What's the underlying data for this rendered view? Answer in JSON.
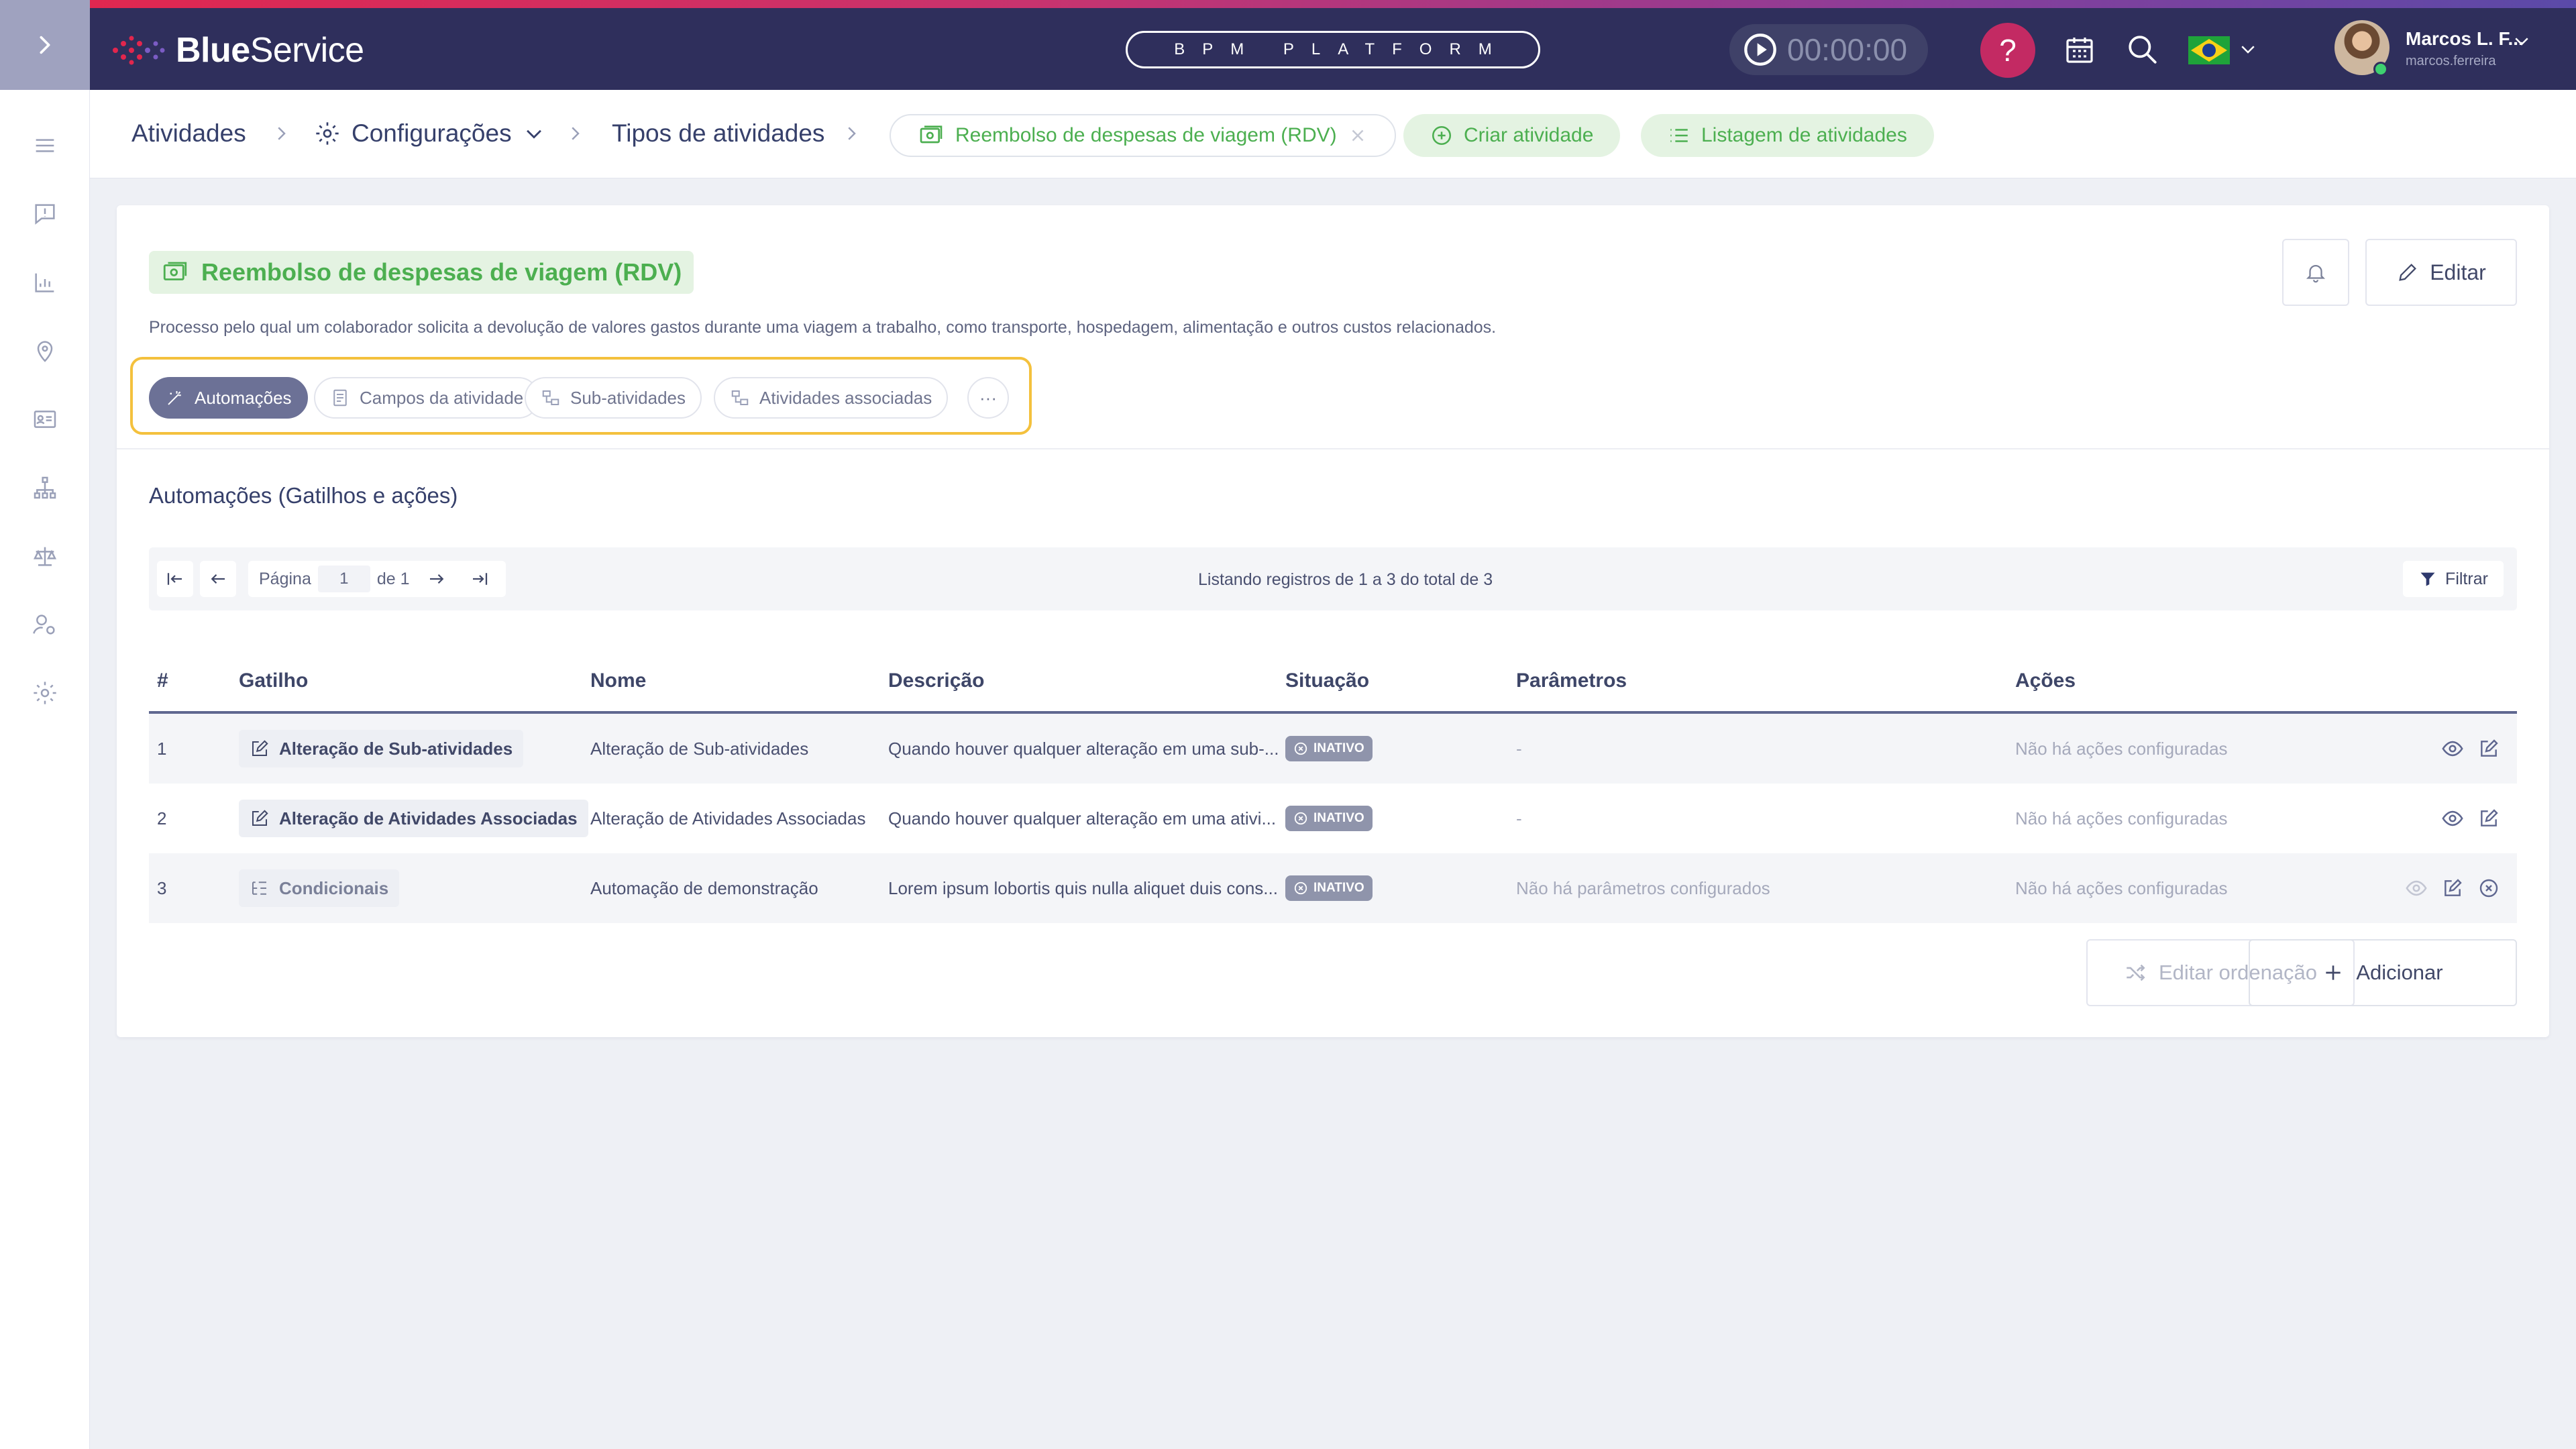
{
  "app": {
    "brand_bold": "Blue",
    "brand_light": "Service",
    "platform_label": "BPM PLATFORM",
    "timer": "00:00:00",
    "help_label": "?",
    "language": "pt-BR",
    "user": {
      "name": "Marcos L. F...",
      "login": "marcos.ferreira"
    },
    "colors": {
      "topbar": "#2f2f5c",
      "accent_green": "#4caf50",
      "highlight": "#f4c13d",
      "status_inactive": "#8f94ab"
    }
  },
  "sidebar": {
    "items": [
      {
        "icon": "list-icon"
      },
      {
        "icon": "alert-message-icon"
      },
      {
        "icon": "bar-chart-icon"
      },
      {
        "icon": "map-pin-icon"
      },
      {
        "icon": "id-card-icon"
      },
      {
        "icon": "org-chart-icon"
      },
      {
        "icon": "scales-icon"
      },
      {
        "icon": "user-settings-icon"
      },
      {
        "icon": "gear-icon"
      }
    ]
  },
  "breadcrumb": {
    "items": [
      "Atividades",
      "Configurações",
      "Tipos de atividades"
    ],
    "current_chip": "Reembolso de despesas de viagem (RDV)",
    "create_chip": "Criar atividade",
    "list_chip": "Listagem de atividades"
  },
  "card": {
    "title": "Reembolso de despesas de viagem (RDV)",
    "description": "Processo pelo qual um colaborador solicita a devolução de valores gastos durante uma viagem a trabalho, como transporte, hospedagem, alimentação e outros custos relacionados.",
    "edit_label": "Editar",
    "tabs": [
      "Automações",
      "Campos da atividade",
      "Sub-atividades",
      "Atividades associadas"
    ],
    "more_label": "···",
    "section_title": "Automações (Gatilhos e ações)"
  },
  "pager": {
    "page_label": "Página",
    "page_value": "1",
    "of_label": "de 1",
    "listing_text": "Listando registros de 1 a 3 do total de 3",
    "filter_label": "Filtrar"
  },
  "table": {
    "headers": [
      "#",
      "Gatilho",
      "Nome",
      "Descrição",
      "Situação",
      "Parâmetros",
      "Ações"
    ],
    "rows": [
      {
        "num": "1",
        "trigger": "Alteração de Sub-atividades",
        "name": "Alteração de Sub-atividades",
        "description": "Quando houver qualquer alteração em uma sub-...",
        "status": "INATIVO",
        "params": "-",
        "actions": "Não há ações configuradas"
      },
      {
        "num": "2",
        "trigger": "Alteração de Atividades Associadas",
        "name": "Alteração de Atividades Associadas",
        "description": "Quando houver qualquer alteração em uma ativi...",
        "status": "INATIVO",
        "params": "-",
        "actions": "Não há ações configuradas"
      },
      {
        "num": "3",
        "trigger": "Condicionais",
        "name": "Automação de demonstração",
        "description": "Lorem ipsum lobortis quis nulla aliquet duis cons...",
        "status": "INATIVO",
        "params": "Não há parâmetros configurados",
        "actions": "Não há ações configuradas"
      }
    ]
  },
  "footer_buttons": {
    "reorder": "Editar ordenação",
    "add": "Adicionar"
  }
}
